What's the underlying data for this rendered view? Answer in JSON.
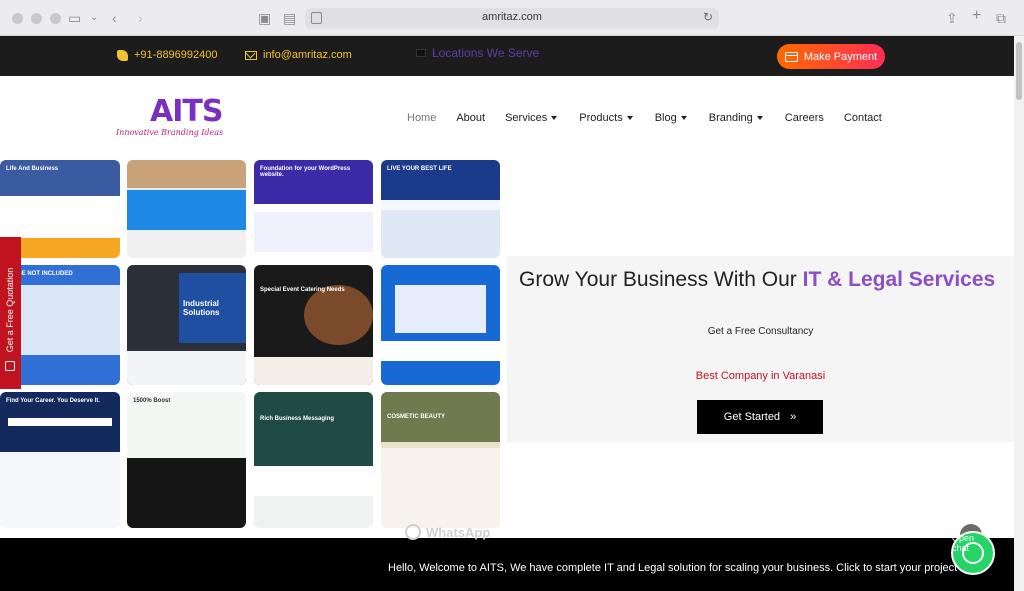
{
  "browser": {
    "url": "amritaz.com"
  },
  "topbar": {
    "phone": "+91-8896992400",
    "email": "info@amritaz.com",
    "locations": "Locations We Serve",
    "payment": "Make Payment"
  },
  "nav": {
    "logo_text": "AITS",
    "logo_tagline": "Innovative Branding Ideas",
    "items": [
      {
        "label": "Home",
        "dropdown": false
      },
      {
        "label": "About",
        "dropdown": false
      },
      {
        "label": "Services",
        "dropdown": true
      },
      {
        "label": "Products",
        "dropdown": true
      },
      {
        "label": "Blog",
        "dropdown": true
      },
      {
        "label": "Branding",
        "dropdown": true
      },
      {
        "label": "Careers",
        "dropdown": false
      },
      {
        "label": "Contact",
        "dropdown": false
      }
    ]
  },
  "side_tab": {
    "label": "Get a Free Quotation"
  },
  "tiles": [
    {
      "caption": "Life And Business"
    },
    {
      "caption": ""
    },
    {
      "caption": "Foundation for your WordPress website."
    },
    {
      "caption": "LIVE YOUR BEST LIFE"
    },
    {
      "caption": "IMAGE NOT INCLUDED"
    },
    {
      "caption": "Industrial Solutions"
    },
    {
      "caption": "Special Event Catering Needs"
    },
    {
      "caption": ""
    },
    {
      "caption": "Find Your Career. You Deserve It."
    },
    {
      "caption": "1500% Boost"
    },
    {
      "caption": "Rich Business Messaging"
    },
    {
      "caption": "COSMETIC BEAUTY"
    }
  ],
  "hero": {
    "title_plain": "Grow Your Business With Our ",
    "title_accent": "IT & Legal Services",
    "subtitle": "Get a Free Consultancy",
    "best": "Best  Company in Varanasi",
    "cta": "Get Started",
    "cta_icon": "»"
  },
  "footer": {
    "whatsapp_label": "WhatsApp",
    "message": "Hello, Welcome to AITS, We have complete IT and Legal solution for scaling your business. Click to start your project now.",
    "open_chat": "Open chat"
  },
  "colors": {
    "accent": "#8c4fc4",
    "brand_red": "#c1121f",
    "topbar_text": "#f1c232",
    "whatsapp": "#25d366"
  }
}
